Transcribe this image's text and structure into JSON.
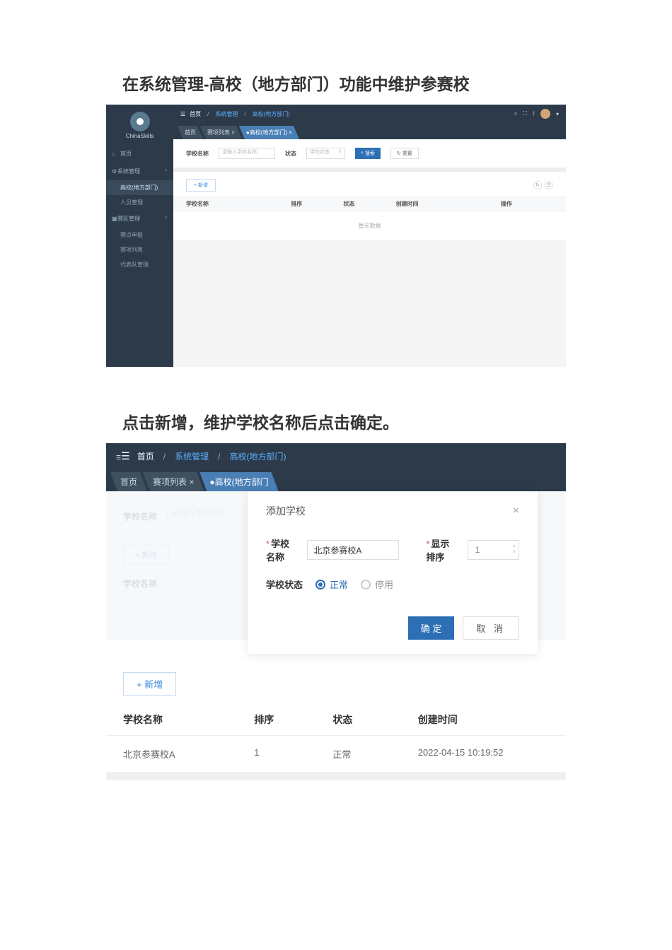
{
  "headings": {
    "h1": "在系统管理-高校（地方部门）功能中维护参赛校",
    "h2": "点击新增，维护学校名称后点击确定。"
  },
  "s1": {
    "brand": "ChinaSkills",
    "nav": {
      "home": "首页",
      "sysmgmt": "系统管理",
      "school": "高校(地方部门)",
      "personnel": "人员管理",
      "zone": "赛区管理",
      "apply": "赛点申报",
      "itemList": "赛项列表",
      "team": "代表队管理"
    },
    "breadcrumb": {
      "home": "首页",
      "sys": "系统管理",
      "school": "高校(地方部门)"
    },
    "tabs": [
      "首页",
      "赛项列表 ×",
      "●高校(地方部门) ×"
    ],
    "filter": {
      "nameLabel": "学校名称",
      "namePh": "请输入学校名称",
      "statusLabel": "状态",
      "statusPh": "学校状态",
      "search": "搜索",
      "reset": "重置"
    },
    "table": {
      "add": "+ 新增",
      "cols": [
        "学校名称",
        "排序",
        "状态",
        "创建时间",
        "操作"
      ],
      "nodata": "暂无数据"
    }
  },
  "s2": {
    "breadcrumb": {
      "home": "首页",
      "sys": "系统管理",
      "school": "高校(地方部门)"
    },
    "tabs": [
      "首页",
      "赛项列表 ×",
      "●高校(地方部门"
    ],
    "filter": {
      "nameLabel": "学校名称",
      "namePh": "请输入学校名称"
    },
    "add": "+ 新增",
    "thcol": "学校名称",
    "modal": {
      "title": "添加学校",
      "nameLabel": "学校名称",
      "nameValue": "北京参赛校A",
      "orderLabel": "显示排序",
      "orderValue": "1",
      "statusLabel": "学校状态",
      "normal": "正常",
      "disabled": "停用",
      "ok": "确 定",
      "cancel": "取 消"
    }
  },
  "s3": {
    "add": "+ 新增",
    "cols": [
      "学校名称",
      "排序",
      "状态",
      "创建时间"
    ],
    "row": [
      "北京参赛校A",
      "1",
      "正常",
      "2022-04-15 10:19:52"
    ]
  }
}
